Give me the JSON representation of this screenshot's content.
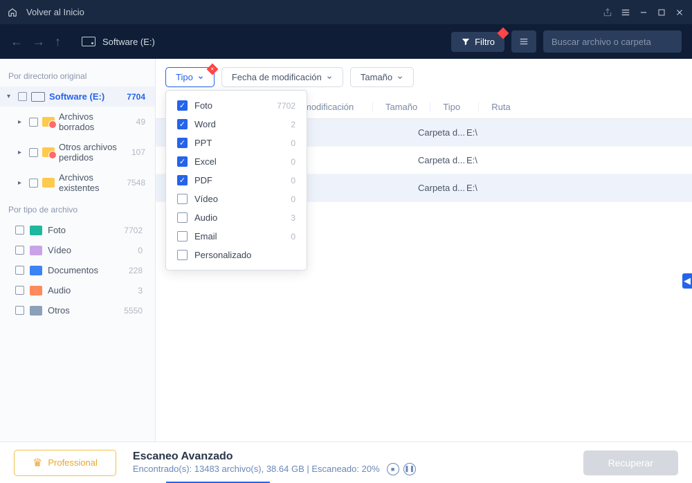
{
  "titlebar": {
    "back_home": "Volver al Inicio"
  },
  "topbar": {
    "path": "Software (E:)",
    "filter_label": "Filtro",
    "search_placeholder": "Buscar archivo o carpeta"
  },
  "sidebar": {
    "section_directory": "Por directorio original",
    "section_filetype": "Por tipo de archivo",
    "root": {
      "label": "Software (E:)",
      "count": "7704"
    },
    "children": [
      {
        "label": "Archivos borrados",
        "count": "49"
      },
      {
        "label": "Otros archivos perdidos",
        "count": "107"
      },
      {
        "label": "Archivos existentes",
        "count": "7548"
      }
    ],
    "types": [
      {
        "label": "Foto",
        "count": "7702"
      },
      {
        "label": "Vídeo",
        "count": "0"
      },
      {
        "label": "Documentos",
        "count": "228"
      },
      {
        "label": "Audio",
        "count": "3"
      },
      {
        "label": "Otros",
        "count": "5550"
      }
    ]
  },
  "filters": {
    "type_label": "Tipo",
    "date_label": "Fecha de modificación",
    "size_label": "Tamaño"
  },
  "dropdown": {
    "items": [
      {
        "label": "Foto",
        "count": "7702",
        "checked": true
      },
      {
        "label": "Word",
        "count": "2",
        "checked": true
      },
      {
        "label": "PPT",
        "count": "0",
        "checked": true
      },
      {
        "label": "Excel",
        "count": "0",
        "checked": true
      },
      {
        "label": "PDF",
        "count": "0",
        "checked": true
      },
      {
        "label": "Vídeo",
        "count": "0",
        "checked": false
      },
      {
        "label": "Audio",
        "count": "3",
        "checked": false
      },
      {
        "label": "Email",
        "count": "0",
        "checked": false
      },
      {
        "label": "Personalizado",
        "count": "",
        "checked": false
      }
    ]
  },
  "table": {
    "headers": {
      "mod": "modificación",
      "size": "Tamaño",
      "type": "Tipo",
      "path": "Ruta"
    },
    "rows": [
      {
        "type": "Carpeta d...",
        "path": "E:\\"
      },
      {
        "type": "Carpeta d...",
        "path": "E:\\"
      },
      {
        "type": "Carpeta d...",
        "path": "E:\\"
      }
    ]
  },
  "footer": {
    "pro_label": "Professional",
    "scan_title": "Escaneo Avanzado",
    "scan_sub": "Encontrado(s): 13483 archivo(s), 38.64 GB | Escaneado: 20%",
    "recover_label": "Recuperar"
  }
}
